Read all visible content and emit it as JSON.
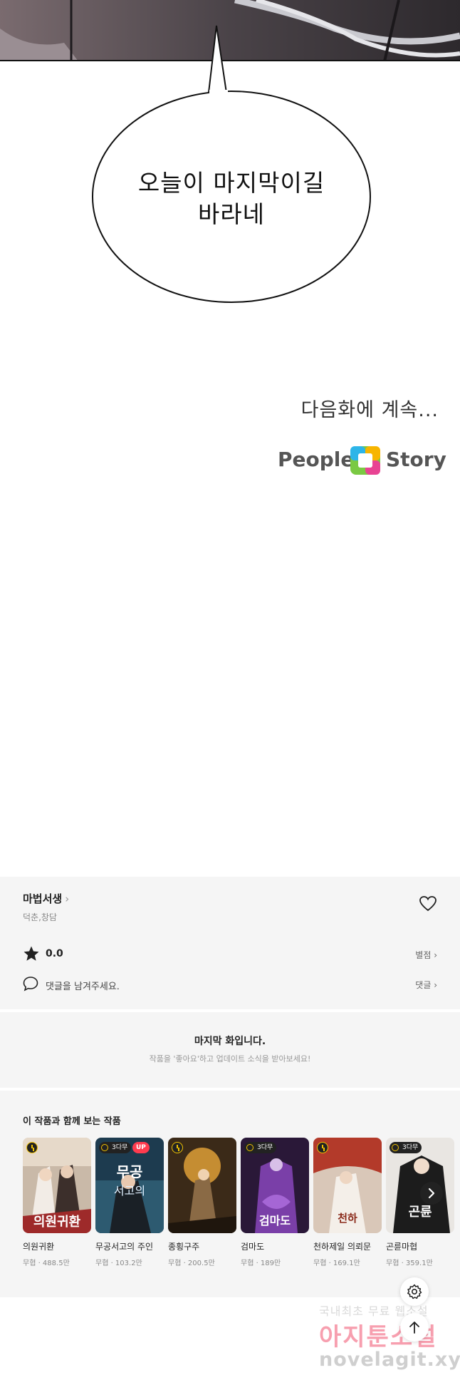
{
  "comic": {
    "speech": [
      "오늘이 마지막이길",
      "바라네"
    ],
    "to_be_continued": "다음화에 계속...",
    "logo": {
      "left": "People",
      "right": "Story"
    }
  },
  "series": {
    "title": "마법서생",
    "title_chevron": "›",
    "authors": "덕춘,창담",
    "rating": "0.0",
    "rate_link": "별점 ›",
    "comment_placeholder": "댓글을 남겨주세요.",
    "comment_link": "댓글 ›"
  },
  "last_episode": {
    "title": "마지막 화입니다.",
    "subtitle": "작품을 '좋아요'하고 업데이트 소식을 받아보세요!"
  },
  "recommendations": {
    "heading": "이 작품과 함께 보는 작품",
    "items": [
      {
        "title": "의원귀환",
        "meta": "무협 · 488.5만",
        "badge": "",
        "up": ""
      },
      {
        "title": "무공서고의 주인",
        "meta": "무협 · 103.2만",
        "badge": "3다무",
        "up": "UP"
      },
      {
        "title": "종횡구주",
        "meta": "무협 · 200.5만",
        "badge": "",
        "up": ""
      },
      {
        "title": "검마도",
        "meta": "무협 · 189만",
        "badge": "3다무",
        "up": ""
      },
      {
        "title": "천하제일 의뢰문",
        "meta": "무협 · 169.1만",
        "badge": "",
        "up": ""
      },
      {
        "title": "곤륜마협",
        "meta": "무협 · 359.1만",
        "badge": "3다무",
        "up": ""
      }
    ]
  },
  "watermark": {
    "line1": "국내최초 무료 웹소설",
    "line2": "아지툰소설",
    "line3": "novelagit.xyz"
  },
  "colors": {
    "panel_bg": "#f5f5f5",
    "up_badge": "#ff3b4e",
    "clock_accent": "#f2c200"
  }
}
